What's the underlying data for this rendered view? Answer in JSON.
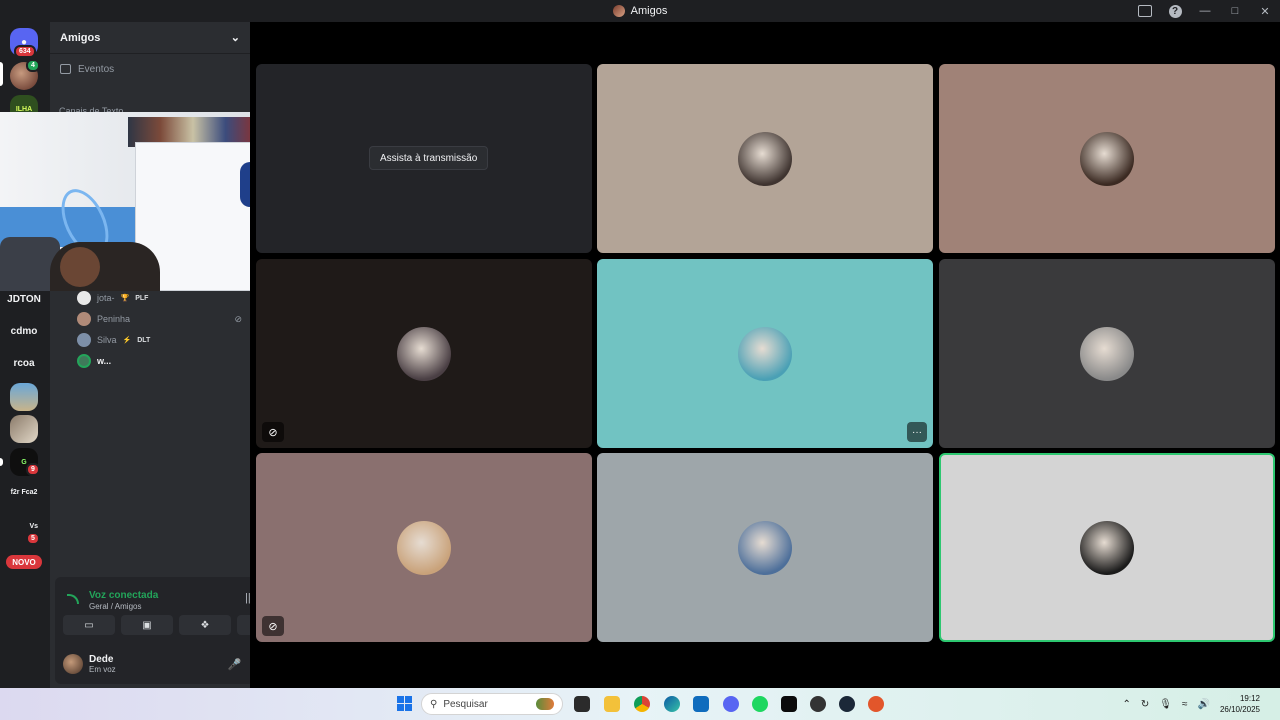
{
  "window": {
    "title": "Amigos"
  },
  "rail": {
    "home_badge": "634",
    "items": [
      {
        "label": "JDTON"
      },
      {
        "label": "cdmo"
      },
      {
        "label": "rcoa"
      },
      {
        "label": "f2r Fca2"
      }
    ],
    "badges": {
      "dm": "9",
      "srv_vs": "5"
    },
    "vs_label": "Vs",
    "novo": "NOVO"
  },
  "sidebar": {
    "server_name": "Amigos",
    "events_label": "Eventos",
    "category_label": "Canais de Texto",
    "voice_users": [
      {
        "name": "jota-",
        "tag": "PLF",
        "tag_icon": "trophy-icon"
      },
      {
        "name": "Peninha",
        "tag": "",
        "muted": true
      },
      {
        "name": "Silva",
        "tag": "DLT",
        "tag_icon": "bolt-icon"
      },
      {
        "name": "w...",
        "tag": ""
      }
    ]
  },
  "voice_panel": {
    "status": "Voz conectada",
    "channel": "Geral / Amigos"
  },
  "user": {
    "name": "Dede",
    "status": "Em voz"
  },
  "stage": {
    "watch_button": "Assista à transmissão"
  },
  "tiles": [
    {
      "bg": "#232428",
      "avatar": null
    },
    {
      "bg": "#b3a497",
      "avatar": "#3f3430"
    },
    {
      "bg": "#a08277",
      "avatar": "#3b2a22"
    },
    {
      "bg": "#1f1a18",
      "avatar": "#4a3f44"
    },
    {
      "bg": "#71c3c2",
      "avatar": "#4aa0b5"
    },
    {
      "bg": "#3a3a3c",
      "avatar": "#8a8a8a"
    },
    {
      "bg": "#8a706f",
      "avatar": "#c9a27a"
    },
    {
      "bg": "#9ea6aa",
      "avatar": "#4d6f9a"
    },
    {
      "bg": "#d4d4d4",
      "avatar": "#1b1b1b"
    }
  ],
  "taskbar": {
    "search_placeholder": "Pesquisar",
    "time": "19:12",
    "date": "26/10/2025"
  },
  "colors": {
    "accent_green": "#23a55a",
    "badge_red": "#da373c",
    "speaking_border": "#2dc770"
  }
}
